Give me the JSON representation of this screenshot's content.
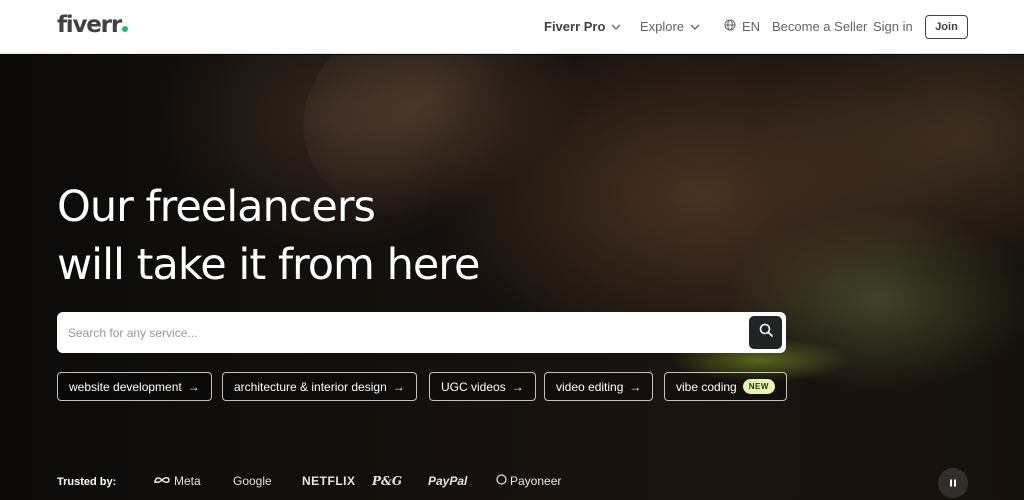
{
  "header": {
    "logo_text": "fiverr",
    "logo_dot_color": "#1dbf73",
    "nav": {
      "fiverr_pro": "Fiverr Pro",
      "explore": "Explore",
      "language": "EN",
      "become_seller": "Become a Seller",
      "sign_in": "Sign in",
      "join": "Join"
    }
  },
  "hero": {
    "title_line1": "Our freelancers",
    "title_line2": "will take it from here",
    "search": {
      "placeholder": "Search for any service..."
    },
    "chips": [
      {
        "label": "website development"
      },
      {
        "label": "architecture & interior design"
      },
      {
        "label": "UGC videos"
      },
      {
        "label": "video editing"
      },
      {
        "label": "vibe coding",
        "badge": "NEW"
      }
    ],
    "trusted": {
      "label": "Trusted by:",
      "brands": [
        "Meta",
        "Google",
        "NETFLIX",
        "P&G",
        "PayPal",
        "Payoneer"
      ]
    }
  }
}
